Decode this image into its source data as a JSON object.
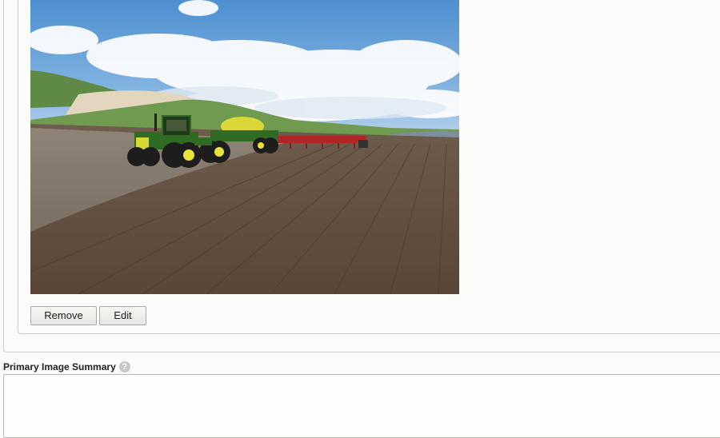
{
  "image_section": {
    "photo_name": "tractor-seeding-field-photo",
    "remove_label": "Remove",
    "edit_label": "Edit"
  },
  "summary_field": {
    "label": "Primary Image Summary",
    "help_icon": "question-circle-icon",
    "help_glyph": "?",
    "value": ""
  },
  "colors": {
    "page_bg": "#fbfbf9",
    "border": "#cfcfcb",
    "help_icon_bg": "#c8c8c4",
    "tractor_green": "#2f6b22",
    "tractor_yellow": "#e8e23a",
    "seeder_red": "#b02525"
  }
}
